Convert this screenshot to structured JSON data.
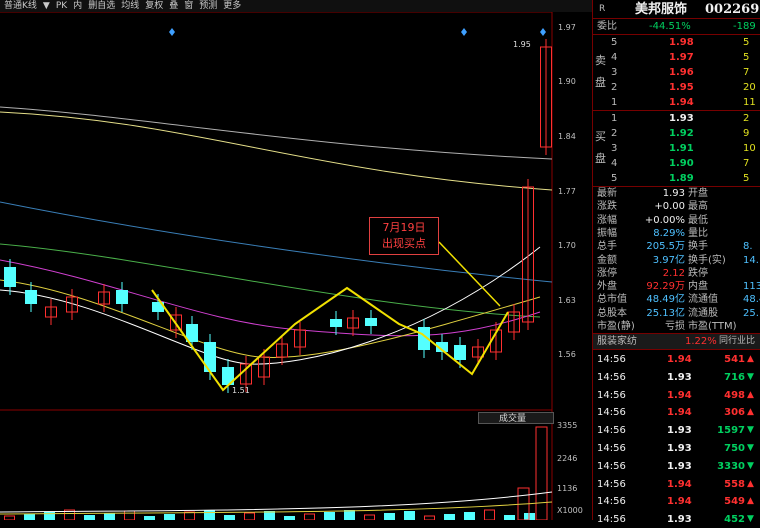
{
  "toolbar": {
    "items": [
      "普通K线",
      "▼",
      "PK",
      "内",
      "删自选",
      "均线",
      "复权",
      "叠",
      "窗",
      "预测",
      "更多"
    ]
  },
  "price_axis": {
    "ticks": [
      "1.97",
      "1.90",
      "1.84",
      "1.77",
      "1.70",
      "1.63",
      "1.56"
    ]
  },
  "annotations": {
    "high_label": "1.95",
    "low_label": "1.51",
    "callout_line1": "7月19日",
    "callout_line2": "出现买点"
  },
  "volume": {
    "title": "成交量",
    "ticks": [
      "3355",
      "2246",
      "1136"
    ],
    "unit": "X1000"
  },
  "header": {
    "letter": "R",
    "stock_name": "美邦服饰",
    "stock_code": "002269"
  },
  "order_book": {
    "weibi_label": "委比",
    "weibi_value": "-44.51%",
    "weibi_right": "-189",
    "sell_label_a": "卖",
    "sell_label_b": "盘",
    "buy_label_a": "买",
    "buy_label_b": "盘",
    "sell": [
      {
        "level": "5",
        "price": "1.98",
        "vol": "5"
      },
      {
        "level": "4",
        "price": "1.97",
        "vol": "5"
      },
      {
        "level": "3",
        "price": "1.96",
        "vol": "7"
      },
      {
        "level": "2",
        "price": "1.95",
        "vol": "20"
      },
      {
        "level": "1",
        "price": "1.94",
        "vol": "11"
      }
    ],
    "buy": [
      {
        "level": "1",
        "price": "1.93",
        "vol": "2"
      },
      {
        "level": "2",
        "price": "1.92",
        "vol": "9"
      },
      {
        "level": "3",
        "price": "1.91",
        "vol": "10"
      },
      {
        "level": "4",
        "price": "1.90",
        "vol": "7"
      },
      {
        "level": "5",
        "price": "1.89",
        "vol": "5"
      }
    ]
  },
  "quote": [
    {
      "l1": "最新",
      "v1": "1.93",
      "l2": "开盘",
      "v2": ""
    },
    {
      "l1": "涨跌",
      "v1": "+0.00",
      "l2": "最高",
      "v2": ""
    },
    {
      "l1": "涨幅",
      "v1": "+0.00%",
      "l2": "最低",
      "v2": ""
    },
    {
      "l1": "振幅",
      "v1": "8.29%",
      "l2": "量比",
      "v2": ""
    },
    {
      "l1": "总手",
      "v1": "205.5万",
      "l2": "换手",
      "v2": "8."
    },
    {
      "l1": "金额",
      "v1": "3.97亿",
      "l2": "换手(实)",
      "v2": "14."
    },
    {
      "l1": "涨停",
      "v1": "2.12",
      "l2": "跌停",
      "v2": ""
    },
    {
      "l1": "外盘",
      "v1": "92.29万",
      "l2": "内盘",
      "v2": "113"
    },
    {
      "l1": "总市值",
      "v1": "48.49亿",
      "l2": "流通值",
      "v2": "48.4"
    },
    {
      "l1": "总股本",
      "v1": "25.13亿",
      "l2": "流通股",
      "v2": "25.1"
    },
    {
      "l1": "市盈(静)",
      "v1": "亏损",
      "l2": "市盈(TTM)",
      "v2": ""
    }
  ],
  "sector": {
    "name": "服装家纺",
    "pct": "1.22%",
    "right": "同行业比"
  },
  "ticks": [
    {
      "time": "14:56",
      "price": "1.94",
      "vol": "541",
      "dir": "up"
    },
    {
      "time": "14:56",
      "price": "1.93",
      "vol": "716",
      "dir": "down"
    },
    {
      "time": "14:56",
      "price": "1.94",
      "vol": "498",
      "dir": "up"
    },
    {
      "time": "14:56",
      "price": "1.94",
      "vol": "306",
      "dir": "up"
    },
    {
      "time": "14:56",
      "price": "1.93",
      "vol": "1597",
      "dir": "down"
    },
    {
      "time": "14:56",
      "price": "1.93",
      "vol": "750",
      "dir": "down"
    },
    {
      "time": "14:56",
      "price": "1.93",
      "vol": "3330",
      "dir": "down"
    },
    {
      "time": "14:56",
      "price": "1.94",
      "vol": "558",
      "dir": "up"
    },
    {
      "time": "14:56",
      "price": "1.94",
      "vol": "549",
      "dir": "up"
    },
    {
      "time": "14:56",
      "price": "1.93",
      "vol": "452",
      "dir": "down"
    }
  ]
}
